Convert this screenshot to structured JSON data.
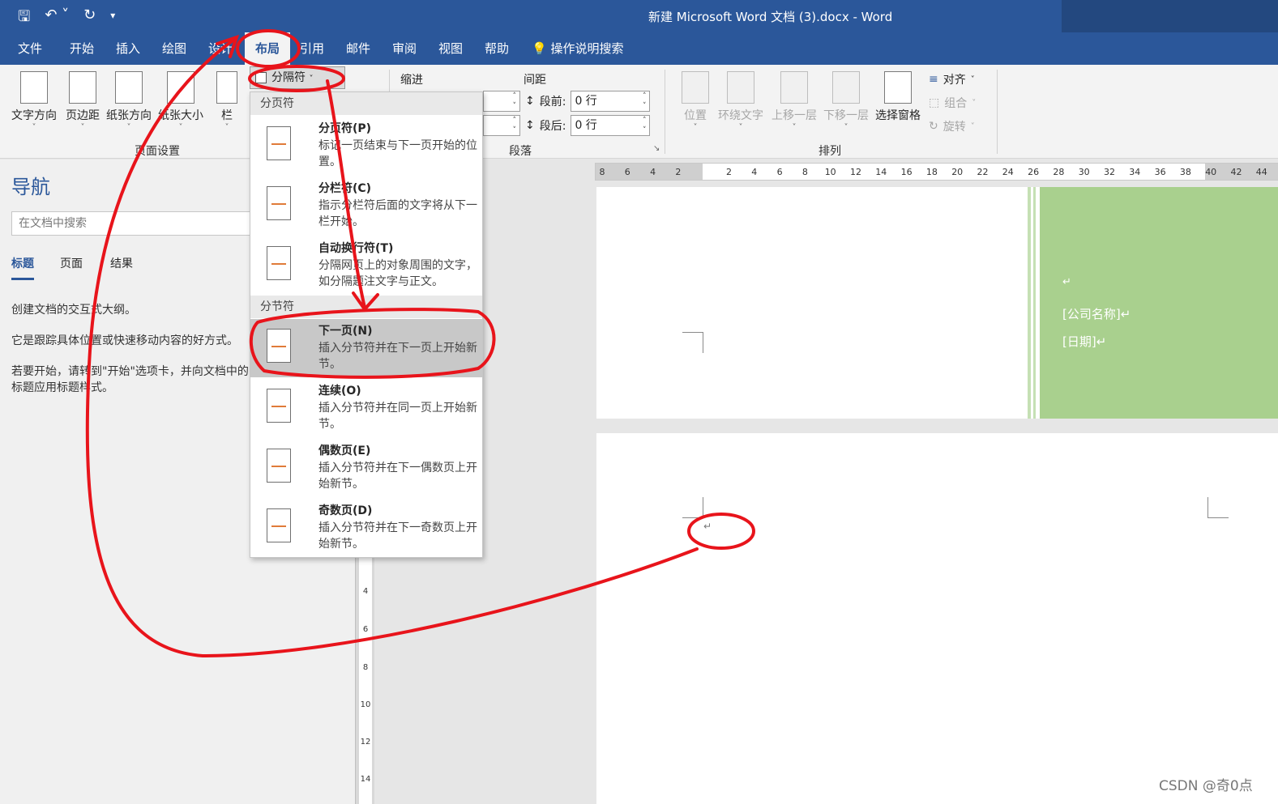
{
  "window": {
    "title": "新建 Microsoft Word 文档 (3).docx  -  Word",
    "qat_icons": [
      "save-icon",
      "undo-icon",
      "redo-icon",
      "customize-icon"
    ]
  },
  "tabs": [
    {
      "label": "文件"
    },
    {
      "label": "开始"
    },
    {
      "label": "插入"
    },
    {
      "label": "绘图"
    },
    {
      "label": "设计"
    },
    {
      "label": "布局"
    },
    {
      "label": "引用"
    },
    {
      "label": "邮件"
    },
    {
      "label": "审阅"
    },
    {
      "label": "视图"
    },
    {
      "label": "帮助"
    }
  ],
  "tell_me": "操作说明搜索",
  "ribbon": {
    "page_setup": {
      "label": "页面设置",
      "buttons": [
        "文字方向",
        "页边距",
        "纸张方向",
        "纸张大小",
        "栏"
      ]
    },
    "breaks_button": "分隔符",
    "paragraph": {
      "label": "段落",
      "indent_label": "缩进",
      "spacing_label": "间距",
      "before_label": "段前:",
      "before_value": "0 行",
      "after_label": "段后:",
      "after_value": "0 行"
    },
    "arrange": {
      "label": "排列",
      "buttons": [
        "位置",
        "环绕文字",
        "上移一层",
        "下移一层",
        "选择窗格"
      ],
      "small": [
        "对齐",
        "组合",
        "旋转"
      ]
    }
  },
  "breaks_menu": {
    "page_breaks_header": "分页符",
    "section_breaks_header": "分节符",
    "items": [
      {
        "title": "分页符(P)",
        "desc": "标记一页结束与下一页开始的位置。"
      },
      {
        "title": "分栏符(C)",
        "desc": "指示分栏符后面的文字将从下一栏开始。"
      },
      {
        "title": "自动换行符(T)",
        "desc": "分隔网页上的对象周围的文字，如分隔题注文字与正文。"
      },
      {
        "title": "下一页(N)",
        "desc": "插入分节符并在下一页上开始新节。"
      },
      {
        "title": "连续(O)",
        "desc": "插入分节符并在同一页上开始新节。"
      },
      {
        "title": "偶数页(E)",
        "desc": "插入分节符并在下一偶数页上开始新节。"
      },
      {
        "title": "奇数页(D)",
        "desc": "插入分节符并在下一奇数页上开始新节。"
      }
    ]
  },
  "nav_pane": {
    "title": "导航",
    "search_placeholder": "在文档中搜索",
    "tabs": [
      "标题",
      "页面",
      "结果"
    ],
    "lines": [
      "创建文档的交互式大纲。",
      "它是跟踪具体位置或快速移动内容的好方式。",
      "若要开始，请转到\"开始\"选项卡，并向文档中的标题应用标题样式。"
    ]
  },
  "ruler": {
    "h_ticks": [
      "8",
      "6",
      "4",
      "2",
      "",
      "2",
      "4",
      "6",
      "8",
      "10",
      "12",
      "14",
      "16",
      "18",
      "20",
      "22",
      "24",
      "26",
      "28",
      "30",
      "32",
      "34",
      "36",
      "38",
      "40",
      "42",
      "44"
    ],
    "v_ticks": [
      "4",
      "6",
      "8",
      "10",
      "12",
      "14"
    ]
  },
  "document": {
    "paragraph_mark": "↵",
    "company": "[公司名称]↵",
    "date": "[日期]↵"
  },
  "watermark": "CSDN @奇0点",
  "colors": {
    "brand": "#2b579a",
    "annotation": "#e8141b",
    "cover_green": "#a9d08e"
  }
}
